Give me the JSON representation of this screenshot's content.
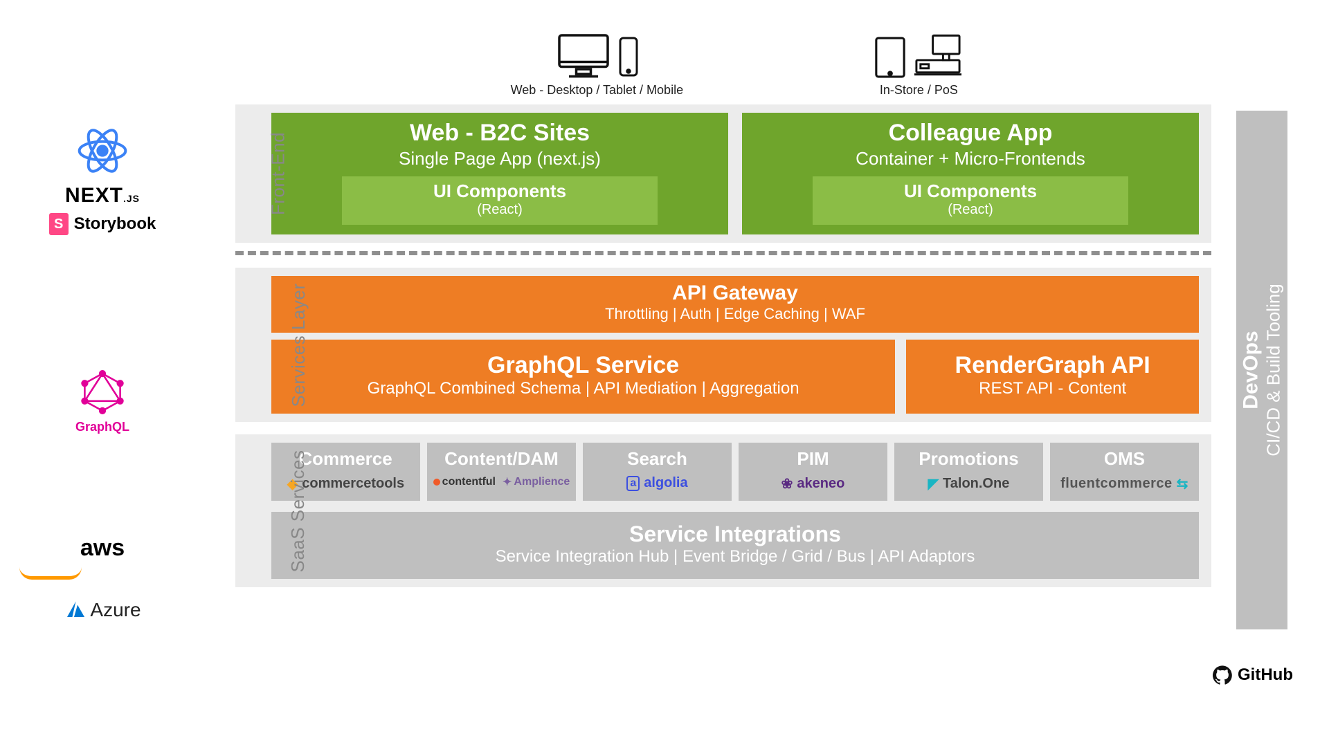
{
  "channels": {
    "web": {
      "label": "Web - Desktop / Tablet / Mobile"
    },
    "store": {
      "label": "In-Store / PoS"
    }
  },
  "frontend": {
    "label": "Front-End",
    "b2c": {
      "title": "Web - B2C Sites",
      "subtitle": "Single Page App (next.js)",
      "ui_title": "UI Components",
      "ui_sub": "(React)"
    },
    "colleague": {
      "title": "Colleague App",
      "subtitle": "Container + Micro-Frontends",
      "ui_title": "UI Components",
      "ui_sub": "(React)"
    },
    "left_logos": {
      "next": "NEXT",
      "next_suffix": ".JS",
      "storybook": "Storybook"
    }
  },
  "services": {
    "label": "Services Layer",
    "gateway": {
      "title": "API Gateway",
      "subtitle": "Throttling | Auth | Edge Caching | WAF"
    },
    "graphql": {
      "title": "GraphQL Service",
      "subtitle": "GraphQL Combined Schema | API Mediation | Aggregation"
    },
    "rendergraph": {
      "title": "RenderGraph API",
      "subtitle": "REST API - Content"
    },
    "left_label": "GraphQL"
  },
  "saas": {
    "label": "SaaS Services",
    "items": [
      {
        "title": "Commerce",
        "vendor": "commercetools"
      },
      {
        "title": "Content/DAM",
        "vendor": "contentful",
        "vendor2": "Amplience"
      },
      {
        "title": "Search",
        "vendor": "algolia"
      },
      {
        "title": "PIM",
        "vendor": "akeneo"
      },
      {
        "title": "Promotions",
        "vendor": "Talon.One"
      },
      {
        "title": "OMS",
        "vendor": "fluentcommerce"
      }
    ],
    "integrations": {
      "title": "Service Integrations",
      "subtitle": "Service Integration Hub | Event Bridge / Grid / Bus | API Adaptors"
    },
    "left_logos": {
      "aws": "aws",
      "azure": "Azure"
    }
  },
  "devops": {
    "title": "DevOps",
    "subtitle": "CI/CD & Build Tooling",
    "github": "GitHub"
  }
}
